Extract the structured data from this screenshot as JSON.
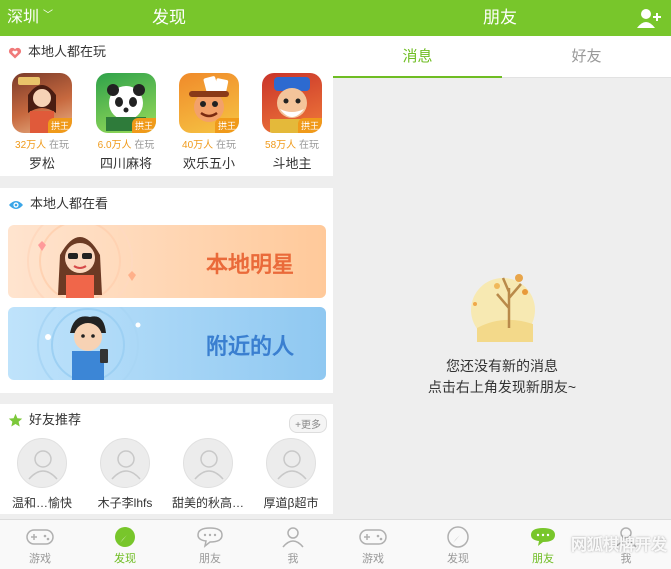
{
  "colors": {
    "brand": "#78c62b",
    "active_tab": "#6fbd23",
    "badge": "#f09a1a"
  },
  "left": {
    "header": {
      "city": "深圳",
      "title": "发现"
    },
    "games": {
      "section_title": "本地人都在玩",
      "items": [
        {
          "name": "罗松",
          "count": "32万人",
          "suffix": "在玩",
          "tag": "拱王"
        },
        {
          "name": "四川麻将",
          "count": "6.0万人",
          "suffix": "在玩",
          "tag": "拱王"
        },
        {
          "name": "欢乐五小",
          "count": "40万人",
          "suffix": "在玩",
          "tag": "拱王"
        },
        {
          "name": "斗地主",
          "count": "58万人",
          "suffix": "在玩",
          "tag": "拱王"
        }
      ]
    },
    "watching": {
      "section_title": "本地人都在看",
      "banners": [
        {
          "text": "本地明星"
        },
        {
          "text": "附近的人"
        }
      ]
    },
    "friends_rec": {
      "section_title": "好友推荐",
      "more_label": "更多",
      "items": [
        {
          "name": "温和…愉快"
        },
        {
          "name": "木子李lhfs"
        },
        {
          "name": "甜美的秋高…"
        },
        {
          "name": "厚道β超市"
        }
      ]
    },
    "tabs": [
      {
        "label": "游戏"
      },
      {
        "label": "发现"
      },
      {
        "label": "朋友"
      },
      {
        "label": "我"
      }
    ]
  },
  "right": {
    "header": {
      "title": "朋友"
    },
    "segments": [
      {
        "label": "消息"
      },
      {
        "label": "好友"
      }
    ],
    "empty": {
      "line1": "您还没有新的消息",
      "line2": "点击右上角发现新朋友~"
    },
    "tabs": [
      {
        "label": "游戏"
      },
      {
        "label": "发现"
      },
      {
        "label": "朋友"
      },
      {
        "label": "我"
      }
    ],
    "watermark": "网狐棋牌开发"
  }
}
